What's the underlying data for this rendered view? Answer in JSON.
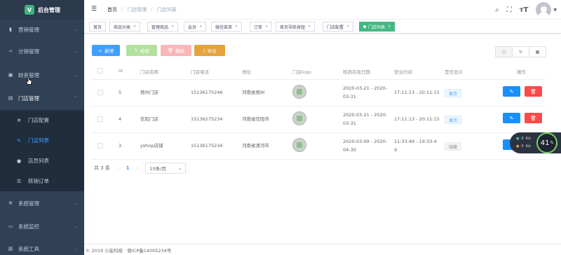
{
  "app": {
    "logo_text": "后台管理",
    "logo_glyph": "V"
  },
  "sidebar": {
    "items": [
      {
        "label": "营销管理",
        "icon": "chart-bar-icon",
        "glyph": "▮"
      },
      {
        "label": "分销管理",
        "icon": "share-icon",
        "glyph": "<"
      },
      {
        "label": "财务管理",
        "icon": "wallet-icon",
        "glyph": "▣"
      },
      {
        "label": "门店管理",
        "icon": "store-icon",
        "glyph": "▤"
      },
      {
        "label": "系统管理",
        "icon": "gear-icon",
        "glyph": "✲"
      },
      {
        "label": "系统监控",
        "icon": "monitor-icon",
        "glyph": "▭"
      },
      {
        "label": "系统工具",
        "icon": "tools-icon",
        "glyph": "▥"
      }
    ],
    "submenu": [
      {
        "label": "门店配置",
        "icon": "gear-icon",
        "glyph": "✲"
      },
      {
        "label": "门店列表",
        "icon": "edit-icon",
        "glyph": "✎"
      },
      {
        "label": "店员列表",
        "icon": "user-icon",
        "glyph": "●"
      },
      {
        "label": "核销订单",
        "icon": "list-icon",
        "glyph": "☰"
      }
    ]
  },
  "navbar": {
    "breadcrumb": [
      "首页",
      "门店管理",
      "门店列表"
    ],
    "separator": "/"
  },
  "tags": [
    {
      "label": "首页",
      "closable": false
    },
    {
      "label": "商品分类",
      "closable": true
    },
    {
      "label": "管理商品",
      "closable": true
    },
    {
      "label": "会员",
      "closable": true
    },
    {
      "label": "微信菜单",
      "closable": true
    },
    {
      "label": "订单",
      "closable": true
    },
    {
      "label": "首页导航按钮",
      "closable": true
    },
    {
      "label": "门店配置",
      "closable": true
    },
    {
      "label": "门店列表",
      "closable": true,
      "active": true
    }
  ],
  "toolbar": {
    "add_label": "新增",
    "edit_label": "修改",
    "delete_label": "删除",
    "export_label": "导出"
  },
  "table": {
    "headers": [
      "id",
      "门店名称",
      "门店电话",
      "地址",
      "门店logo",
      "核销有效日期",
      "营业时间",
      "是否显示",
      "操作"
    ],
    "rows": [
      {
        "id": "5",
        "name": "郑州门店",
        "phone": "15136175246",
        "address": "河南省郑州",
        "date_start": "2020-03-21 - 2020-",
        "date_end": "03-31",
        "hours": "17:11:13 - 20:11:15",
        "hours2": "",
        "visible": "显示",
        "visible_state": "show"
      },
      {
        "id": "4",
        "name": "信阳门店",
        "phone": "15136275234",
        "address": "河南省信阳市",
        "date_start": "2020-03-21 - 2020-",
        "date_end": "03-31",
        "hours": "17:11:13 - 20:11:15",
        "hours2": "",
        "visible": "显示",
        "visible_state": "show"
      },
      {
        "id": "3",
        "name": "yshop店铺",
        "phone": "15136175234",
        "address": "河南省漯河市",
        "date_start": "2020-03-09 - 2020-",
        "date_end": "04-30",
        "hours": "11:33:49 - 19:33:4",
        "hours2": "9",
        "visible": "隐藏",
        "visible_state": "hide"
      }
    ]
  },
  "pagination": {
    "total": "共 3 条",
    "current_page": "1",
    "page_size": "10条/页"
  },
  "footer": {
    "text": "© 2019 小盐科技 · 晋ICP备14005234号"
  },
  "net_widget": {
    "up": "0",
    "up_unit": "K/s",
    "down": "0",
    "down_unit": "K/s",
    "percent": "41",
    "percent_unit": "%"
  },
  "colors": {
    "sidebar_bg": "#304156",
    "primary": "#409eff",
    "success": "#42b983",
    "danger": "#ff4949",
    "warning": "#e6a23c"
  }
}
